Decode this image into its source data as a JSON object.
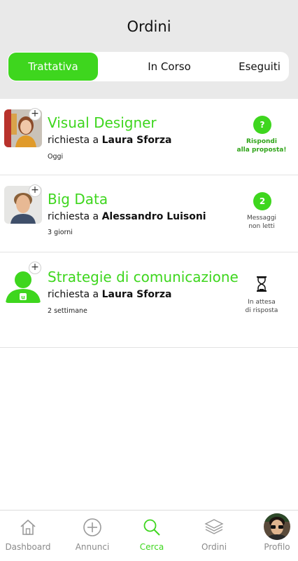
{
  "header": {
    "title": "Ordini",
    "tabs": [
      {
        "label": "Trattativa"
      },
      {
        "label": "In Corso"
      },
      {
        "label": "Eseguiti"
      }
    ]
  },
  "orders": [
    {
      "title": "Visual Designer",
      "request_prefix": "richiesta a",
      "person": "Laura Sforza",
      "time": "Oggi",
      "badge": "?",
      "status_line1": "Rispondi",
      "status_line2": "alla proposta!"
    },
    {
      "title": "Big Data",
      "request_prefix": "richiesta a",
      "person": "Alessandro Luisoni",
      "time": "3 giorni",
      "badge": "2",
      "status_line1": "Messaggi",
      "status_line2": "non letti"
    },
    {
      "title": "Strategie di comunicazione",
      "request_prefix": "richiesta a",
      "person": "Laura Sforza",
      "time": "2 settimane",
      "status_line1": "In attesa",
      "status_line2": "di risposta"
    }
  ],
  "tabbar": {
    "items": [
      {
        "label": "Dashboard",
        "icon": "home-icon"
      },
      {
        "label": "Annunci",
        "icon": "plus-circle-icon"
      },
      {
        "label": "Cerca",
        "icon": "search-icon"
      },
      {
        "label": "Ordini",
        "icon": "layers-icon"
      },
      {
        "label": "Profilo",
        "icon": "profile-avatar"
      }
    ]
  },
  "colors": {
    "accent": "#3ed61e",
    "header_bg": "#e9e9e9"
  }
}
